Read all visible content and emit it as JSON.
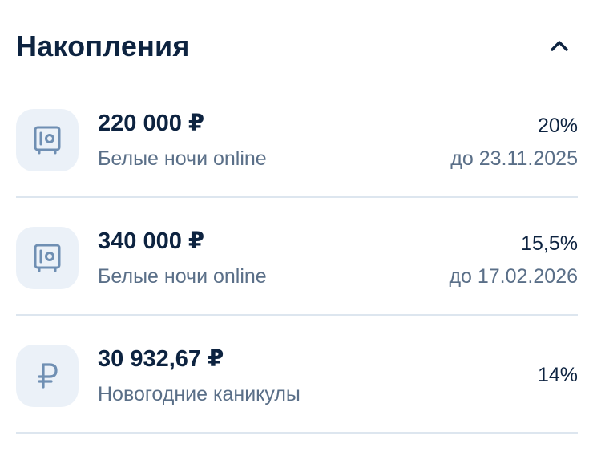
{
  "section": {
    "title": "Накопления",
    "collapse_icon": "chevron-up-icon"
  },
  "colors": {
    "text_primary": "#0d2340",
    "text_secondary": "#5a6f88",
    "icon_color": "#6f8fb3",
    "icon_bg": "#ebf1f8",
    "divider": "#dde6ef"
  },
  "accounts": [
    {
      "icon": "safe-icon",
      "amount": "220 000 ₽",
      "name": "Белые ночи online",
      "rate": "20%",
      "term": "до 23.11.2025"
    },
    {
      "icon": "safe-icon",
      "amount": "340 000 ₽",
      "name": "Белые ночи online",
      "rate": "15,5%",
      "term": "до 17.02.2026"
    },
    {
      "icon": "ruble-icon",
      "amount": "30 932,67 ₽",
      "name": "Новогодние каникулы",
      "rate": "14%",
      "term": ""
    }
  ]
}
